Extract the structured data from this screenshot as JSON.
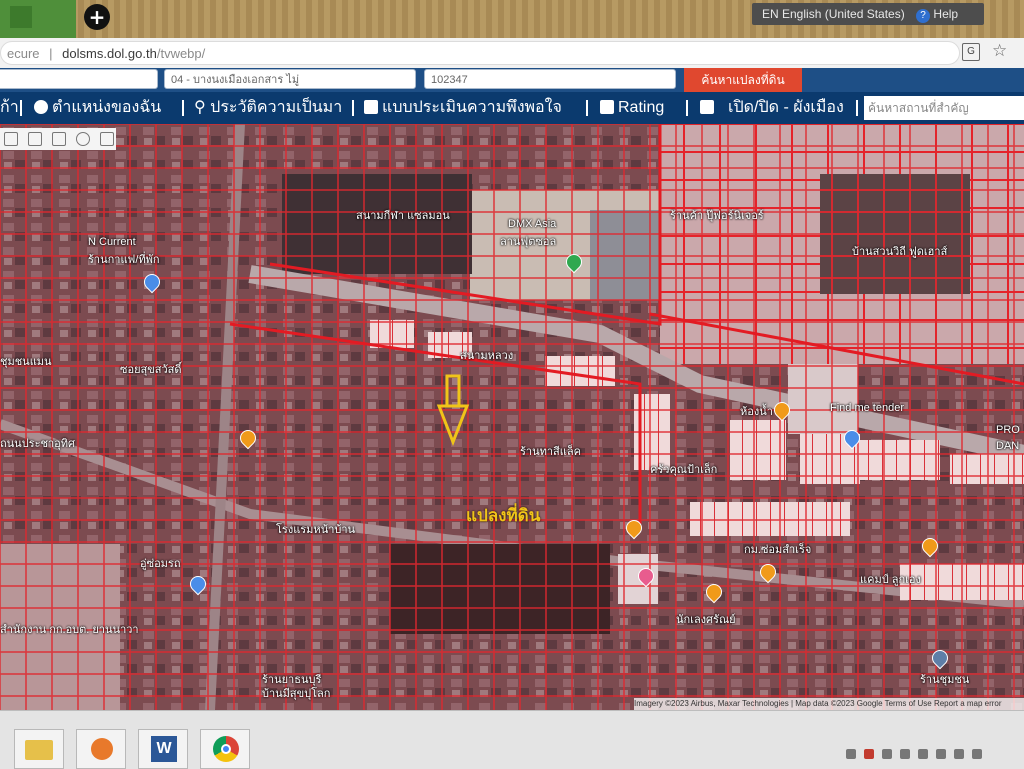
{
  "desktop": {
    "add_button": "+",
    "language_bar": "EN English (United States)",
    "help": "Help",
    "help_glyph": "?"
  },
  "browser": {
    "url_prefix": "ecure",
    "url_sep": "|",
    "url_host": "dolsms.dol.go.th",
    "url_path": "/tvwebp/",
    "translate_icon": "translate-icon",
    "star_icon": "star-icon"
  },
  "search_form": {
    "field1": "",
    "field2": "04 - บางนงเมืองเอกสาร ไมู่",
    "field3": "102347",
    "search_button": "ค้นหาแปลงที่ดิน"
  },
  "nav": {
    "item0": "ก้า",
    "item1": "ตำแหน่งของฉัน",
    "item2": "ประวัติความเป็นมา",
    "item3": "แบบประเมินความพึงพอใจ",
    "item4": "Rating",
    "item5": "เปิด/ปิด - ผังเมือง",
    "search_placeholder": "ค้นหาสถานที่สำคัญ"
  },
  "map": {
    "parcel_label": "แปลงที่ดิน",
    "labels": {
      "l_ncurrent": "N Current",
      "l_ncurrent_sub": "ร้านกาแฟ/ที่พัก",
      "l_dmx": "DMX Asia",
      "l_dmx_sub": "ลานฟุตซอล",
      "l_pool": "สนามกีฬา แซลมอน",
      "l_rightcenter": "ร้านค้า ปุ๊ฟอร์นิเจอร์",
      "l_rightcorner": "บ้านสวนวิถี ฟูดเฮาส์",
      "l_tender": "Find me tender",
      "l_bathroom": "ห้องน้ำ",
      "l_road": "ถนนประชาอุทิศ",
      "l_pro": "PRO",
      "l_pro2": "DAN",
      "l_kitchen": "ครัวคุณป้าเล็ก",
      "l_shop": "ร้านทาสีแล็ค",
      "l_soi": "ซอยสุขสวัสดิ์",
      "l_sanam": "สนามหลวง",
      "l_mid": "โรงแรมหน้าบ้าน",
      "l_garage": "อู่ซ่อมรถ",
      "l_school": "สำนักงาน กก.อบต. ยานนาวา",
      "l_bottomc": "ร้านยาธนบุรี",
      "l_bottomc2": "บ้านมีสุขปุโลก",
      "l_bottomr": "กม.ซ่อมสำเร็จ",
      "l_bottomr2": "แคมป์ ลูกเอง",
      "l_bottomr3": "นักเลงศรัณย์",
      "l_nn": "ชุมชนแมน",
      "l_temple": "ร้านชุมชน"
    },
    "attribution": "Imagery ©2023 Airbus, Maxar Technologies | Map data ©2023 Google  Terms of Use  Report a map error",
    "tools": [
      "pin-tool-icon",
      "measure-icon",
      "square-icon",
      "settings-icon",
      "hand-icon"
    ]
  },
  "taskbar": {
    "apps": [
      "file-explorer-icon",
      "media-player-icon",
      "word-icon",
      "chrome-icon"
    ],
    "word_letter": "W"
  }
}
